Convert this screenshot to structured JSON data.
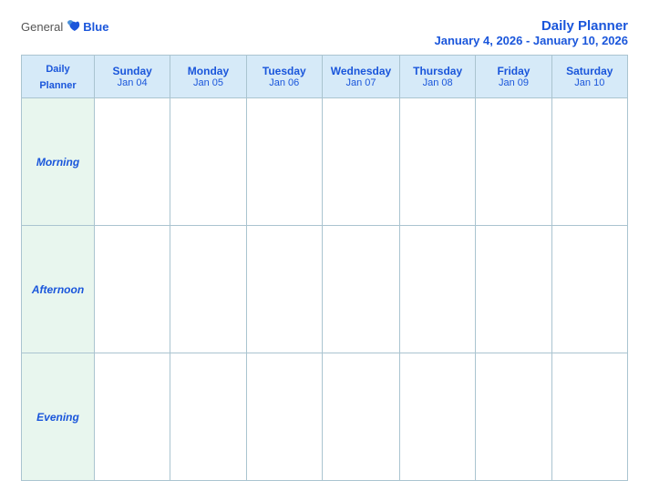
{
  "header": {
    "logo_general": "General",
    "logo_blue": "Blue",
    "title": "Daily Planner",
    "date_range": "January 4, 2026 - January 10, 2026"
  },
  "columns": [
    {
      "day": "Daily\nPlanner",
      "date": ""
    },
    {
      "day": "Sunday",
      "date": "Jan 04"
    },
    {
      "day": "Monday",
      "date": "Jan 05"
    },
    {
      "day": "Tuesday",
      "date": "Jan 06"
    },
    {
      "day": "Wednesday",
      "date": "Jan 07"
    },
    {
      "day": "Thursday",
      "date": "Jan 08"
    },
    {
      "day": "Friday",
      "date": "Jan 09"
    },
    {
      "day": "Saturday",
      "date": "Jan 10"
    }
  ],
  "rows": [
    {
      "label": "Morning"
    },
    {
      "label": "Afternoon"
    },
    {
      "label": "Evening"
    }
  ]
}
